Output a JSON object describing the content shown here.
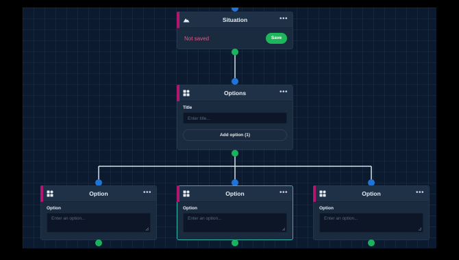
{
  "nodes": {
    "situation": {
      "title": "Situation",
      "icon": "mountain-icon",
      "more": "•••",
      "status": "Not saved",
      "save_label": "Save"
    },
    "options": {
      "title": "Options",
      "icon": "blocks-icon",
      "more": "•••",
      "field_label": "Title",
      "field_placeholder": "Enter title...",
      "add_button": "Add option (1)"
    },
    "option_nodes": [
      {
        "title": "Option",
        "icon": "blocks-icon",
        "more": "•••",
        "field_label": "Option",
        "field_placeholder": "Enter an option..."
      },
      {
        "title": "Option",
        "icon": "blocks-icon",
        "more": "•••",
        "field_label": "Option",
        "field_placeholder": "Enter an option...",
        "selected": true
      },
      {
        "title": "Option",
        "icon": "blocks-icon",
        "more": "•••",
        "field_label": "Option",
        "field_placeholder": "Enter an option..."
      }
    ]
  },
  "colors": {
    "canvas": "#0b1a2f",
    "node": "#1a2a3f",
    "accent": "#b3166f",
    "input_port": "#1f74d6",
    "output_port": "#1ab35d",
    "save": "#1eb65a",
    "not_saved": "#e05a86",
    "selected_border": "#2fb5a8"
  }
}
